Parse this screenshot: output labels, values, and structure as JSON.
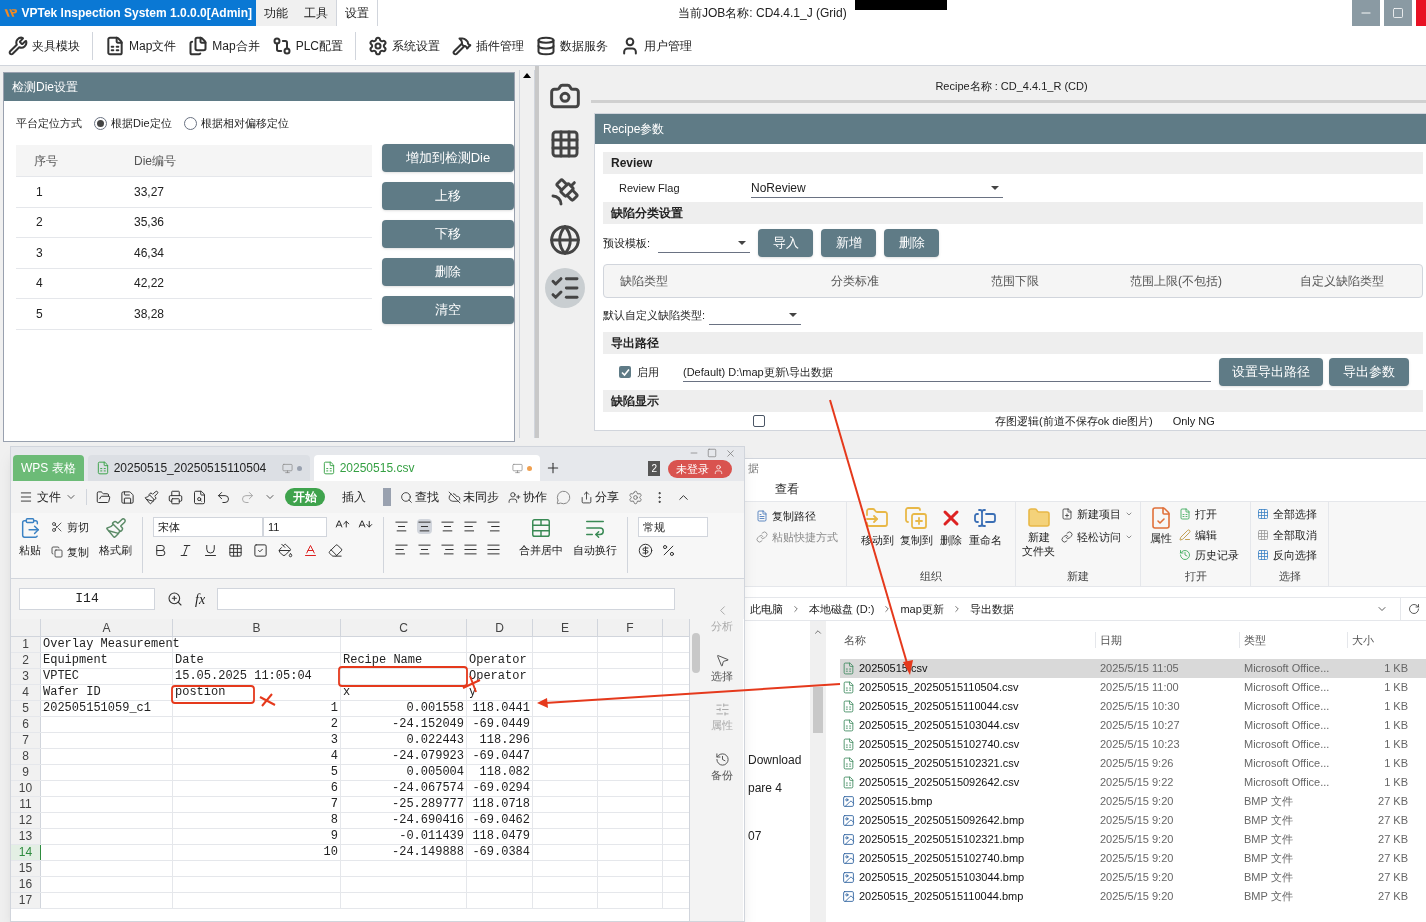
{
  "app": {
    "title": "VPTek Inspection System 1.0.0.0[Admin]",
    "menus": [
      {
        "label": "功能",
        "selected": false
      },
      {
        "label": "工具",
        "selected": false
      },
      {
        "label": "设置",
        "selected": true
      }
    ],
    "job": "当前JOB名称:  CD4.4.1_J (Grid)",
    "toolbar": [
      "夹具模块",
      "Map文件",
      "Map合并",
      "PLC配置",
      "系统设置",
      "插件管理",
      "数据服务",
      "用户管理"
    ]
  },
  "die_panel": {
    "title": "检测Die设置",
    "mode_label": "平台定位方式",
    "modes": [
      {
        "label": "根据Die定位",
        "selected": true
      },
      {
        "label": "根据相对偏移定位",
        "selected": false
      }
    ],
    "columns": [
      "序号",
      "Die编号"
    ],
    "rows": [
      [
        "1",
        "33,27"
      ],
      [
        "2",
        "35,36"
      ],
      [
        "3",
        "46,34"
      ],
      [
        "4",
        "42,22"
      ],
      [
        "5",
        "38,28"
      ]
    ],
    "buttons": [
      "增加到检测Die",
      "上移",
      "下移",
      "删除",
      "清空"
    ]
  },
  "side_icons": [
    {
      "selected": false
    },
    {
      "selected": false
    },
    {
      "selected": false
    },
    {
      "selected": false
    },
    {
      "selected": true
    }
  ],
  "recipe": {
    "name": "Recipe名称 : CD_4.4.1_R (CD)",
    "title": "Recipe参数",
    "review": {
      "heading": "Review",
      "flag_label": "Review Flag",
      "flag_value": "NoReview"
    },
    "defect": {
      "heading": "缺陷分类设置",
      "template_label": "预设模板:",
      "buttons": [
        "导入",
        "新增",
        "删除"
      ],
      "columns": [
        "缺陷类型",
        "分类标准",
        "范围下限",
        "范围上限(不包括)",
        "自定义缺陷类型"
      ],
      "default_label": "默认自定义缺陷类型:"
    },
    "export": {
      "heading": "导出路径",
      "enable_label": "启用",
      "enabled": true,
      "path": "(Default) D:\\map更新\\导出数据",
      "buttons": [
        "设置导出路径",
        "导出参数"
      ]
    },
    "display": {
      "heading": "缺陷显示",
      "checked": false,
      "logic_label": "存图逻辑(前道不保存ok die图片)",
      "logic_value": "Only NG"
    }
  },
  "wps": {
    "app_tab": "WPS 表格",
    "tabs": [
      {
        "label": "20250515_20250515110504",
        "selected": false
      },
      {
        "label": "20250515.csv",
        "selected": true
      }
    ],
    "window_count": "2",
    "login": "未登录",
    "menu": "文件",
    "ribbon_tabs": [
      {
        "label": "开始",
        "selected": true
      },
      {
        "label": "插入",
        "selected": false
      }
    ],
    "actions": [
      "查找",
      "未同步",
      "协作",
      "分享"
    ],
    "paste": "粘贴",
    "cut": "剪切",
    "copy": "复制",
    "format_painter": "格式刷",
    "font": "宋体",
    "size": "11",
    "merge": "合并居中",
    "wrap": "自动换行",
    "number_format": "常规",
    "cell_ref": "I14",
    "fx": "fx",
    "columns": [
      "A",
      "B",
      "C",
      "D",
      "E",
      "F"
    ],
    "rows": [
      {
        "n": "1",
        "selected": false,
        "cells": {
          "A": "Overlay Measurement"
        }
      },
      {
        "n": "2",
        "selected": false,
        "cells": {
          "A": "Equipment",
          "B": "Date",
          "C": "Recipe Name",
          "D": "Operator"
        }
      },
      {
        "n": "3",
        "selected": false,
        "cells": {
          "A": "VPTEC",
          "B": "15.05.2025 11:05:04",
          "D": "Operator"
        }
      },
      {
        "n": "4",
        "selected": false,
        "cells": {
          "A": "Wafer ID",
          "B": "postion",
          "C": "x",
          "D": "y"
        }
      },
      {
        "n": "5",
        "selected": false,
        "cells": {
          "A": "202505151059_c1",
          "B": "1",
          "C": "0.001558",
          "D": "118.0441"
        }
      },
      {
        "n": "6",
        "selected": false,
        "cells": {
          "B": "2",
          "C": "-24.152049",
          "D": "-69.0449"
        }
      },
      {
        "n": "7",
        "selected": false,
        "cells": {
          "B": "3",
          "C": "0.022443",
          "D": "118.296"
        }
      },
      {
        "n": "8",
        "selected": false,
        "cells": {
          "B": "4",
          "C": "-24.079923",
          "D": "-69.0447"
        }
      },
      {
        "n": "9",
        "selected": false,
        "cells": {
          "B": "5",
          "C": "0.005004",
          "D": "118.082"
        }
      },
      {
        "n": "10",
        "selected": false,
        "cells": {
          "B": "6",
          "C": "-24.067574",
          "D": "-69.0294"
        }
      },
      {
        "n": "11",
        "selected": false,
        "cells": {
          "B": "7",
          "C": "-25.289777",
          "D": "118.0718"
        }
      },
      {
        "n": "12",
        "selected": false,
        "cells": {
          "B": "8",
          "C": "-24.690416",
          "D": "-69.0462"
        }
      },
      {
        "n": "13",
        "selected": false,
        "cells": {
          "B": "9",
          "C": "-0.011439",
          "D": "118.0479"
        }
      },
      {
        "n": "14",
        "selected": true,
        "cells": {
          "B": "10",
          "C": "-24.149888",
          "D": "-69.0384"
        }
      },
      {
        "n": "15",
        "selected": false,
        "cells": {}
      },
      {
        "n": "16",
        "selected": false,
        "cells": {}
      },
      {
        "n": "17",
        "selected": false,
        "cells": {}
      }
    ],
    "side": [
      "分析",
      "选择",
      "属性",
      "备份"
    ]
  },
  "explorer": {
    "title_fragment": "据",
    "tab": "查看",
    "clipboard": [
      "复制路径",
      "粘贴快捷方式"
    ],
    "organize": {
      "name": "组织",
      "items": [
        "移动到",
        "复制到",
        "删除",
        "重命名"
      ]
    },
    "new": {
      "name": "新建",
      "folder": [
        "新建",
        "文件夹"
      ],
      "items": [
        "新建项目",
        "轻松访问"
      ]
    },
    "open": {
      "name": "打开",
      "props": "属性",
      "items": [
        "打开",
        "编辑",
        "历史记录"
      ]
    },
    "select": {
      "name": "选择",
      "items": [
        "全部选择",
        "全部取消",
        "反向选择"
      ]
    },
    "breadcrumb": [
      "此电脑",
      "本地磁盘 (D:)",
      "map更新",
      "导出数据"
    ],
    "nav": [
      "Download",
      "pare 4",
      "07"
    ],
    "columns": [
      "名称",
      "日期",
      "类型",
      "大小"
    ],
    "files": [
      {
        "name": "20250515.csv",
        "date": "2025/5/15 11:05",
        "type": "Microsoft Office...",
        "size": "1 KB",
        "kind": "csv",
        "selected": true
      },
      {
        "name": "20250515_20250515110504.csv",
        "date": "2025/5/15 11:00",
        "type": "Microsoft Office...",
        "size": "1 KB",
        "kind": "csv",
        "selected": false
      },
      {
        "name": "20250515_20250515110044.csv",
        "date": "2025/5/15 10:30",
        "type": "Microsoft Office...",
        "size": "1 KB",
        "kind": "csv",
        "selected": false
      },
      {
        "name": "20250515_20250515103044.csv",
        "date": "2025/5/15 10:27",
        "type": "Microsoft Office...",
        "size": "1 KB",
        "kind": "csv",
        "selected": false
      },
      {
        "name": "20250515_20250515102740.csv",
        "date": "2025/5/15 10:23",
        "type": "Microsoft Office...",
        "size": "1 KB",
        "kind": "csv",
        "selected": false
      },
      {
        "name": "20250515_20250515102321.csv",
        "date": "2025/5/15 9:26",
        "type": "Microsoft Office...",
        "size": "1 KB",
        "kind": "csv",
        "selected": false
      },
      {
        "name": "20250515_20250515092642.csv",
        "date": "2025/5/15 9:22",
        "type": "Microsoft Office...",
        "size": "1 KB",
        "kind": "csv",
        "selected": false
      },
      {
        "name": "20250515.bmp",
        "date": "2025/5/15 9:20",
        "type": "BMP 文件",
        "size": "27 KB",
        "kind": "bmp",
        "selected": false
      },
      {
        "name": "20250515_20250515092642.bmp",
        "date": "2025/5/15 9:20",
        "type": "BMP 文件",
        "size": "27 KB",
        "kind": "bmp",
        "selected": false
      },
      {
        "name": "20250515_20250515102321.bmp",
        "date": "2025/5/15 9:20",
        "type": "BMP 文件",
        "size": "27 KB",
        "kind": "bmp",
        "selected": false
      },
      {
        "name": "20250515_20250515102740.bmp",
        "date": "2025/5/15 9:20",
        "type": "BMP 文件",
        "size": "27 KB",
        "kind": "bmp",
        "selected": false
      },
      {
        "name": "20250515_20250515103044.bmp",
        "date": "2025/5/15 9:20",
        "type": "BMP 文件",
        "size": "27 KB",
        "kind": "bmp",
        "selected": false
      },
      {
        "name": "20250515_20250515110044.bmp",
        "date": "2025/5/15 9:20",
        "type": "BMP 文件",
        "size": "27 KB",
        "kind": "bmp",
        "selected": false
      }
    ]
  }
}
